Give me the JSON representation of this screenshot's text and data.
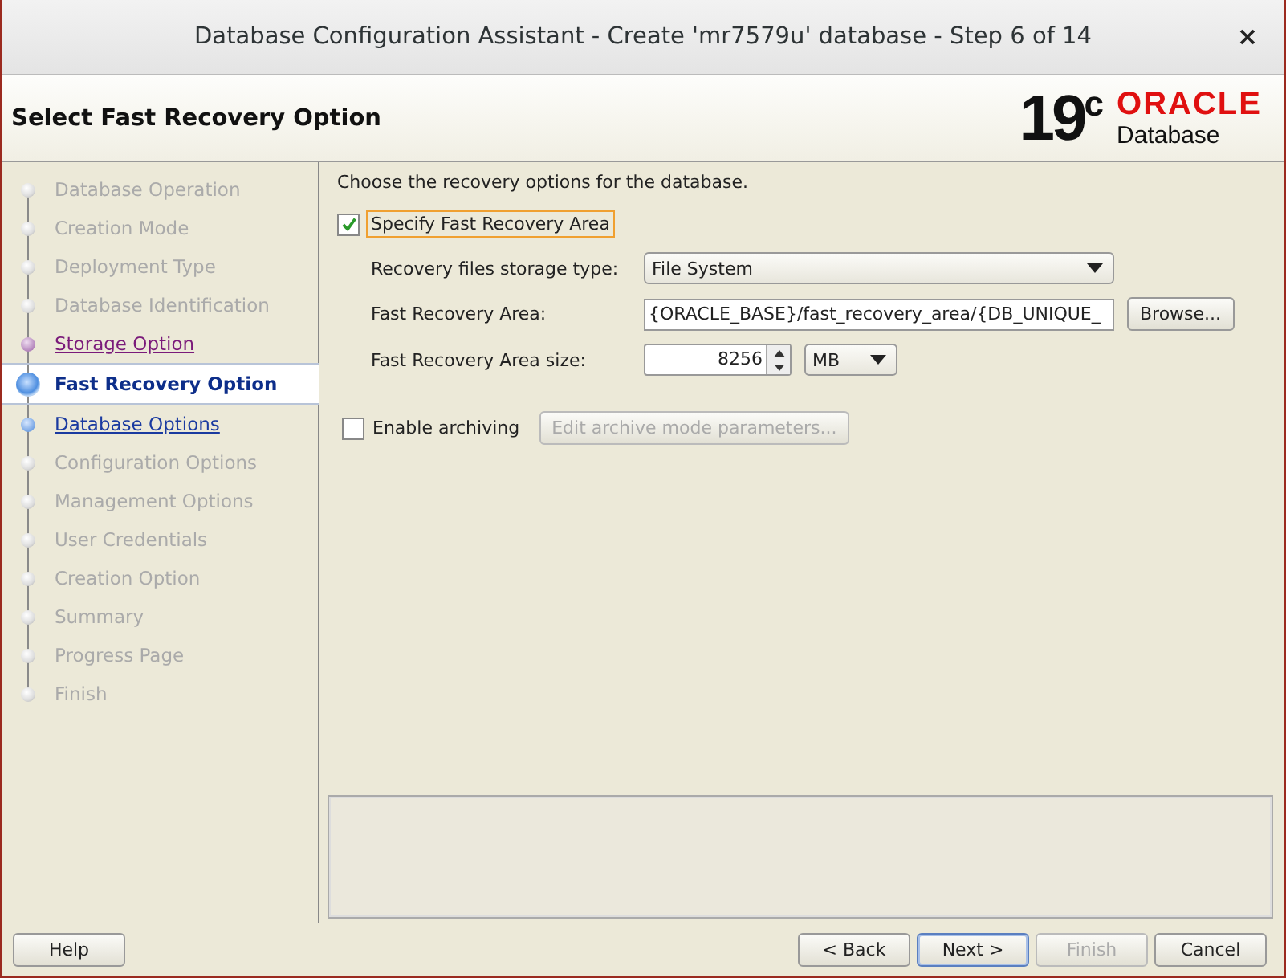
{
  "window": {
    "title": "Database Configuration Assistant - Create 'mr7579u' database - Step 6 of 14"
  },
  "header": {
    "title": "Select Fast Recovery Option",
    "logo": {
      "version": "19",
      "version_sup": "c",
      "brand": "ORACLE",
      "product": "Database"
    }
  },
  "steps": [
    {
      "label": "Database Operation",
      "kind": "pending",
      "selected": false
    },
    {
      "label": "Creation Mode",
      "kind": "pending",
      "selected": false
    },
    {
      "label": "Deployment Type",
      "kind": "pending",
      "selected": false
    },
    {
      "label": "Database Identification",
      "kind": "pending",
      "selected": false
    },
    {
      "label": "Storage Option",
      "kind": "visited",
      "selected": false
    },
    {
      "label": "Fast Recovery Option",
      "kind": "visited",
      "selected": true
    },
    {
      "label": "Database Options",
      "kind": "next",
      "selected": false
    },
    {
      "label": "Configuration Options",
      "kind": "pending",
      "selected": false
    },
    {
      "label": "Management Options",
      "kind": "pending",
      "selected": false
    },
    {
      "label": "User Credentials",
      "kind": "pending",
      "selected": false
    },
    {
      "label": "Creation Option",
      "kind": "pending",
      "selected": false
    },
    {
      "label": "Summary",
      "kind": "pending",
      "selected": false
    },
    {
      "label": "Progress Page",
      "kind": "pending",
      "selected": false
    },
    {
      "label": "Finish",
      "kind": "pending",
      "selected": false
    }
  ],
  "content": {
    "intro": "Choose the recovery options for the database.",
    "specify_fra": {
      "label": "Specify Fast Recovery Area",
      "checked": true
    },
    "storage_type": {
      "label": "Recovery files storage type:",
      "value": "File System"
    },
    "fra_location": {
      "label": "Fast Recovery Area:",
      "value": "{ORACLE_BASE}/fast_recovery_area/{DB_UNIQUE_",
      "button": "Browse..."
    },
    "fra_size": {
      "label": "Fast Recovery Area size:",
      "value": "8256",
      "unit": "MB"
    },
    "archiving": {
      "label": "Enable archiving",
      "checked": false,
      "button": "Edit archive mode parameters...",
      "button_disabled": true
    }
  },
  "buttons": [
    {
      "label": "Help",
      "disabled": false,
      "focused": false
    },
    {
      "label": "< Back",
      "disabled": false,
      "focused": false
    },
    {
      "label": "Next >",
      "disabled": false,
      "focused": true
    },
    {
      "label": "Finish",
      "disabled": true,
      "focused": false
    },
    {
      "label": "Cancel",
      "disabled": false,
      "focused": false
    }
  ]
}
